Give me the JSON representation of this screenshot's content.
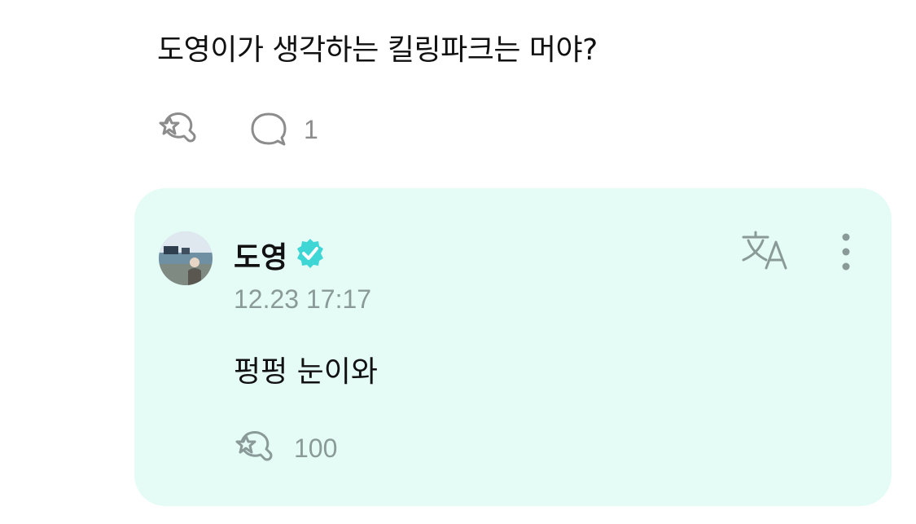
{
  "post": {
    "text": "도영이가 생각하는 킬링파크는 머야?",
    "reactions_icon": "reaction-star-bubble-icon",
    "comment_icon": "comment-bubble-icon",
    "comment_count": "1"
  },
  "reply": {
    "author": "도영",
    "verified_icon": "verified-badge-icon",
    "timestamp": "12.23 17:17",
    "text": "펑펑 눈이와",
    "translate_icon": "translate-icon",
    "more_icon": "more-vertical-icon",
    "reaction_count": "100"
  },
  "colors": {
    "card_background": "#e5fcf6",
    "verified_badge": "#3fd6d6",
    "muted_gray": "#8c8c8c",
    "muted_teal_gray": "#8a9a98"
  }
}
